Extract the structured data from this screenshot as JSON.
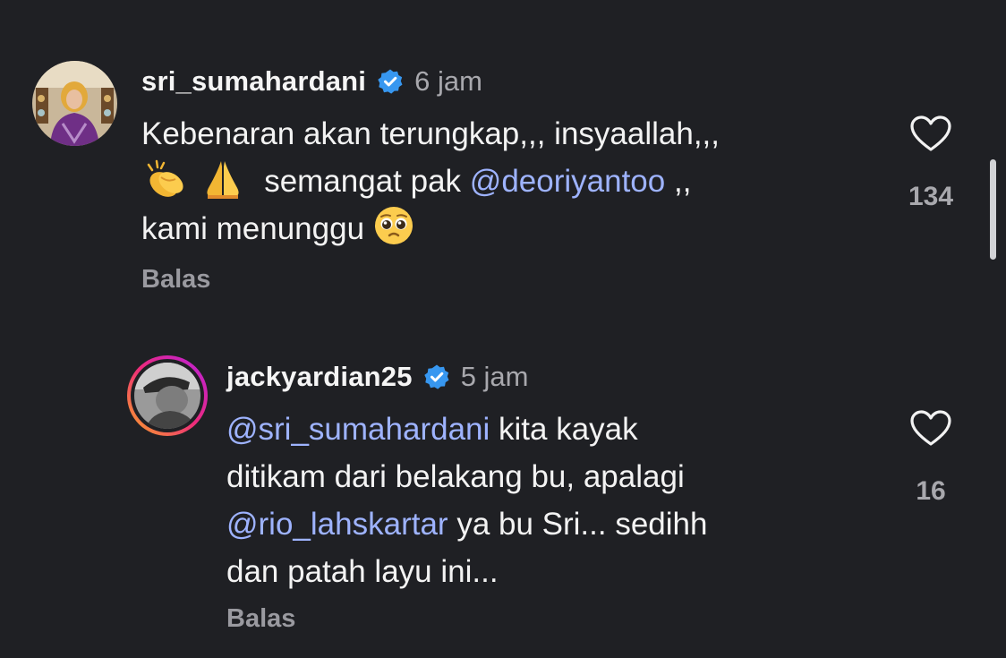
{
  "comments": [
    {
      "username": "sri_sumahardani",
      "time": "6 jam",
      "body_line1": "Kebenaran akan terungkap,,, insyaallah,,,",
      "body_line2_text": "semangat pak",
      "body_line2_mention": "@deoriyantoo",
      "body_line2_end": ",,",
      "body_line3": "kami menunggu",
      "reply_label": "Balas",
      "likes": "134"
    },
    {
      "username": "jackyardian25",
      "time": "5 jam",
      "body_line1_mention": "@sri_sumahardani",
      "body_line1_text": "kita kayak",
      "body_line2": "ditikam dari belakang bu, apalagi",
      "body_line3_mention": "@rio_lahskartar",
      "body_line3_text": "ya bu Sri... sedihh",
      "body_line4": "dan patah layu ini...",
      "reply_label": "Balas",
      "likes": "16"
    }
  ],
  "icons": {
    "verified": "verified-badge-icon",
    "like": "heart-outline-icon",
    "clap": "clapping-hands-emoji",
    "pray": "folded-hands-emoji",
    "tearful": "pleading-face-emoji"
  },
  "colors": {
    "background": "#1f2024",
    "mention": "#9eb3ff",
    "verified": "#3797f0",
    "muted": "#a8a8ad"
  }
}
